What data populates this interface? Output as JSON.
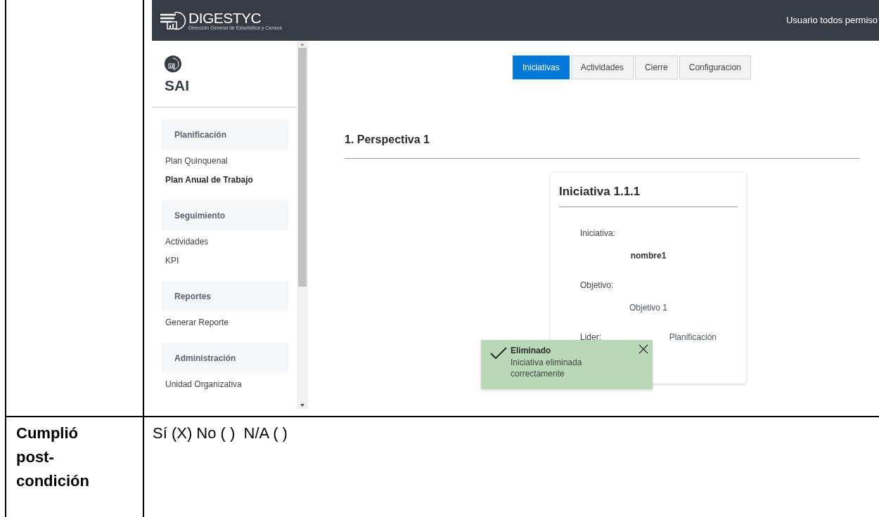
{
  "header": {
    "logo_text": "DIGESTYC",
    "logo_subtitle": "Dirección General de Estadística y Censos",
    "user": "Usuario todos permiso"
  },
  "sidebar": {
    "app_name": "SAI",
    "sections": [
      {
        "title": "Planificación",
        "items": [
          {
            "label": "Plan Quinquenal",
            "selected": false
          },
          {
            "label": "Plan Anual de Trabajo",
            "selected": true
          }
        ]
      },
      {
        "title": "Seguimiento",
        "items": [
          {
            "label": "Actividades",
            "selected": false
          },
          {
            "label": "KPI",
            "selected": false
          }
        ]
      },
      {
        "title": "Reportes",
        "items": [
          {
            "label": "Generar Reporte",
            "selected": false
          }
        ]
      },
      {
        "title": "Administración",
        "items": [
          {
            "label": "Unidad Organizativa",
            "selected": false
          }
        ]
      }
    ]
  },
  "tabs": [
    {
      "label": "Iniciativas",
      "selected": true
    },
    {
      "label": "Actividades",
      "selected": false
    },
    {
      "label": "Cierre",
      "selected": false
    },
    {
      "label": "Configuracion",
      "selected": false
    }
  ],
  "section_heading": "1. Perspectiva 1",
  "card": {
    "title": "Iniciativa 1.1.1",
    "fields": [
      {
        "kind": "stacked",
        "label": "Iniciativa:",
        "value": "nombre1",
        "bold": true
      },
      {
        "kind": "stacked",
        "label": "Objetivo:",
        "value": "Objetivo 1",
        "bold": false
      },
      {
        "kind": "inline",
        "label": "Lider:",
        "value": "Planificación",
        "bold": false
      }
    ]
  },
  "toast": {
    "title": "Eliminado",
    "message": "Iniciativa eliminada correctamente"
  },
  "document": {
    "row_label": "Cumplió post-condición",
    "row_value": "Sí (X) No ( )  N/A ( )"
  }
}
